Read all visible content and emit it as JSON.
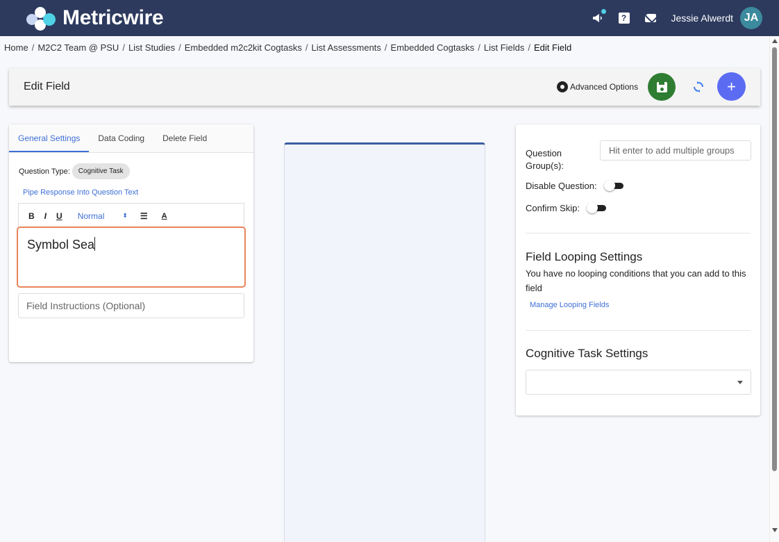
{
  "app": {
    "brand": "Metricwire",
    "accent": "#2d3a5e"
  },
  "nav": {
    "icons": [
      "megaphone-icon",
      "help-icon",
      "mail-icon"
    ],
    "user_name": "Jessie Alwerdt",
    "user_initials": "JA"
  },
  "breadcrumb": [
    "Home",
    "M2C2 Team @ PSU",
    "List Studies",
    "Embedded m2c2kit Cogtasks",
    "List Assessments",
    "Embedded Cogtasks",
    "List Fields",
    "Edit Field"
  ],
  "header": {
    "title": "Edit Field",
    "advanced_options": "Advanced Options"
  },
  "left": {
    "tabs": [
      "General Settings",
      "Data Coding",
      "Delete Field"
    ],
    "question_type_label": "Question Type:",
    "question_type_value": "Cognitive Task",
    "pipe_link": "Pipe Response Into Question Text",
    "toolbar": {
      "bold": "B",
      "italic": "I",
      "underline": "U",
      "size": "Normal"
    },
    "editor_text": "Symbol Sea",
    "instructions_placeholder": "Field Instructions (Optional)"
  },
  "right": {
    "question_groups_label": "Question Group(s):",
    "question_groups_placeholder": "Hit enter to add multiple groups",
    "disable_question_label": "Disable Question:",
    "confirm_skip_label": "Confirm Skip:",
    "looping_title": "Field Looping Settings",
    "looping_text": "You have no looping conditions that you can add to this field",
    "manage_looping_link": "Manage Looping Fields",
    "cog_title": "Cognitive Task Settings",
    "cog_select_value": ""
  }
}
